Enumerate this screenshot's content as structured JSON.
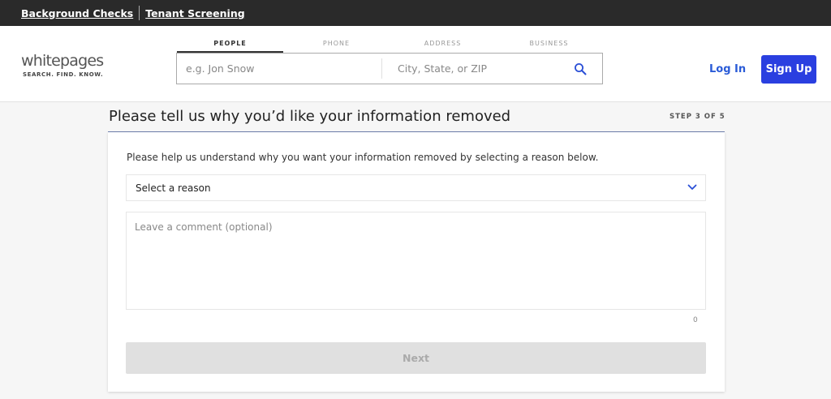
{
  "topbar": {
    "links": [
      "Background Checks",
      "Tenant Screening"
    ]
  },
  "header": {
    "logo": {
      "word": "whitepages",
      "tagline": "SEARCH. FIND. KNOW."
    },
    "tabs": [
      {
        "label": "PEOPLE",
        "active": true
      },
      {
        "label": "PHONE",
        "active": false
      },
      {
        "label": "ADDRESS",
        "active": false
      },
      {
        "label": "BUSINESS",
        "active": false
      }
    ],
    "search": {
      "name_placeholder": "e.g. Jon Snow",
      "location_placeholder": "City, State, or ZIP",
      "icon": "search-icon"
    },
    "login_label": "Log In",
    "signup_label": "Sign Up"
  },
  "main": {
    "title": "Please tell us why you’d like your information removed",
    "step": "STEP 3 OF 5",
    "instructions": "Please help us understand why you want your information removed by selecting a reason below.",
    "reason_select": {
      "value": "Select a reason",
      "icon": "chevron-down-icon"
    },
    "comment_placeholder": "Leave a comment (optional)",
    "char_count": "0",
    "next_label": "Next"
  },
  "colors": {
    "accent": "#2a3fe0",
    "link": "#2a5bd7",
    "topbar": "#2a2a2a"
  }
}
